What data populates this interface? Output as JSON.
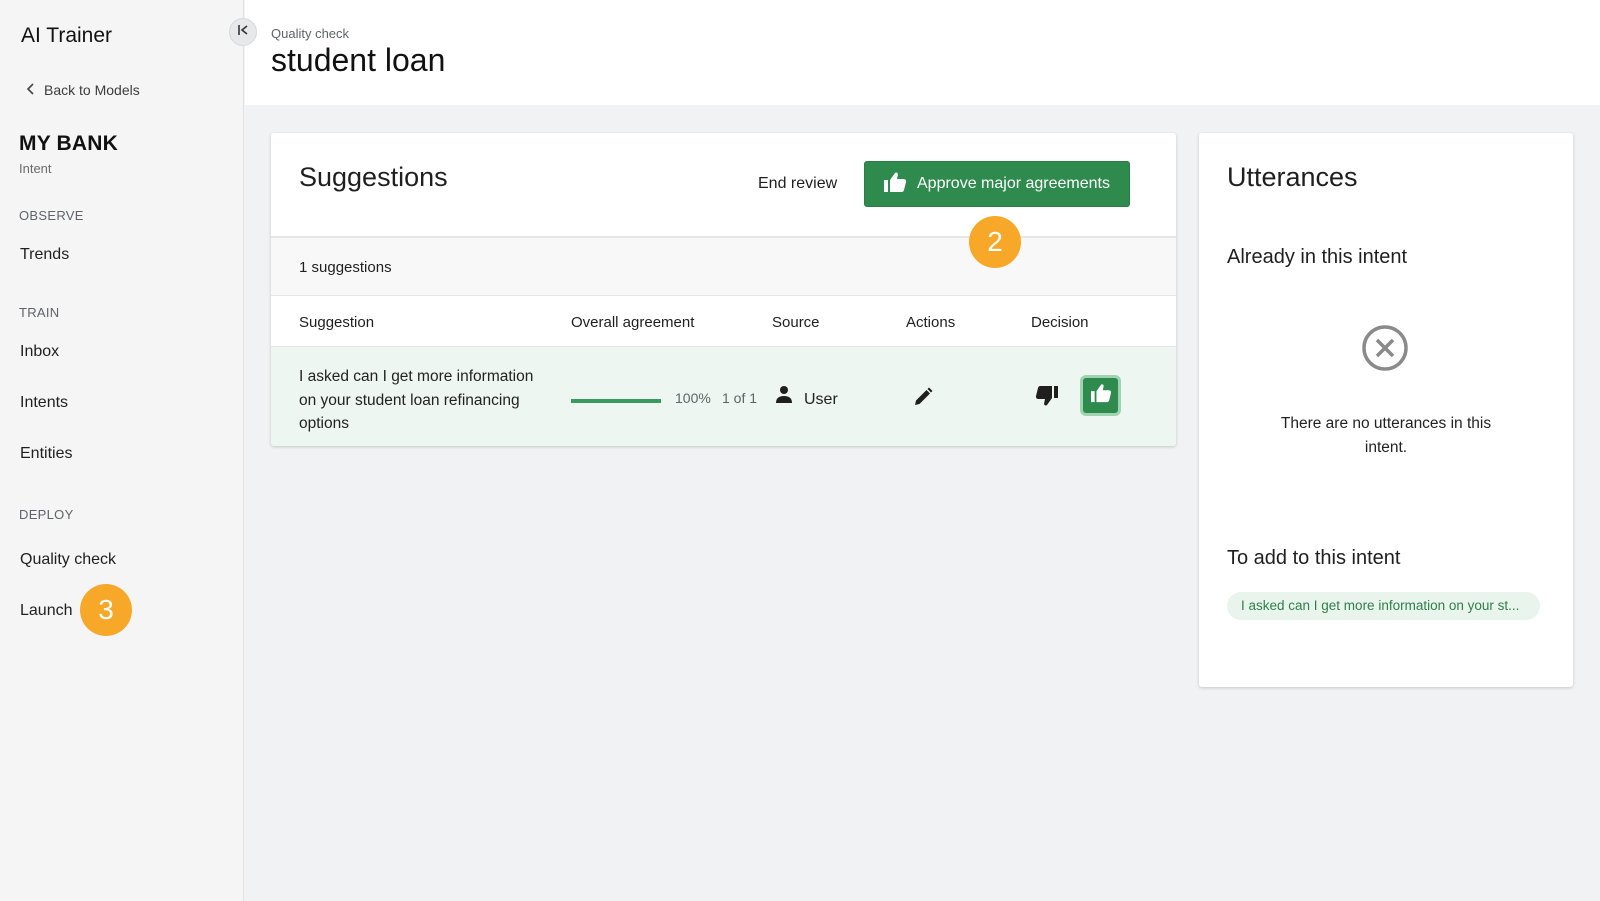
{
  "sidebar": {
    "app_title": "AI Trainer",
    "back_label": "Back to Models",
    "model_name": "MY BANK",
    "model_sub": "Intent",
    "sections": {
      "observe": "OBSERVE",
      "train": "TRAIN",
      "deploy": "DEPLOY"
    },
    "items": {
      "trends": "Trends",
      "inbox": "Inbox",
      "intents": "Intents",
      "entities": "Entities",
      "quality_check": "Quality check",
      "launch": "Launch"
    },
    "launch_badge": "3"
  },
  "header": {
    "breadcrumb": "Quality check",
    "title": "student loan"
  },
  "suggestions": {
    "title": "Suggestions",
    "end_review_label": "End review",
    "approve_label": "Approve major agreements",
    "approve_badge": "2",
    "count_text": "1 suggestions",
    "columns": {
      "suggestion": "Suggestion",
      "agreement": "Overall agreement",
      "source": "Source",
      "actions": "Actions",
      "decision": "Decision"
    },
    "rows": [
      {
        "text": "I asked can I get more information on your student loan refinancing options",
        "agreement_pct": "100%",
        "agreement_value": 1.0,
        "agreement_count": "1 of 1",
        "source": "User"
      }
    ]
  },
  "utterances": {
    "title": "Utterances",
    "already_heading": "Already in this intent",
    "empty_text": "There are no utterances in this intent.",
    "to_add_heading": "To add to this intent",
    "chip_text": "I asked can I get more information on your st..."
  },
  "colors": {
    "accent_green": "#2f8a4d",
    "badge_orange": "#f7a829"
  },
  "icons": [
    "collapse-icon",
    "chevron-left-icon",
    "thumbs-up-icon",
    "person-icon",
    "pencil-icon",
    "thumbs-down-icon",
    "close-circle-icon"
  ]
}
